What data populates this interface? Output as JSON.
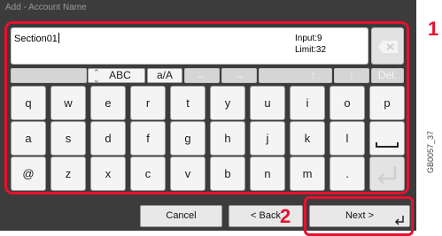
{
  "window": {
    "title": "Add - Account Name"
  },
  "input": {
    "value": "Section01",
    "count_label": "Input:9",
    "limit_label": "Limit:32"
  },
  "controls": {
    "abc_label": "ABC",
    "case_label": "a/A",
    "delete_label": "Del."
  },
  "keys": {
    "row1": [
      "q",
      "w",
      "e",
      "r",
      "t",
      "y",
      "u",
      "i",
      "o",
      "p"
    ],
    "row2": [
      "a",
      "s",
      "d",
      "f",
      "g",
      "h",
      "j",
      "k",
      "l"
    ],
    "row3": [
      "@",
      "z",
      "x",
      "c",
      "v",
      "b",
      "n",
      "m",
      "."
    ]
  },
  "buttons": {
    "cancel": "Cancel",
    "back": "< Back",
    "next": "Next >"
  },
  "callouts": {
    "one": "1",
    "two": "2"
  },
  "figure_code": "GB0057_37",
  "colors": {
    "highlight": "#e8102f",
    "panel": "#3c3c3c"
  }
}
